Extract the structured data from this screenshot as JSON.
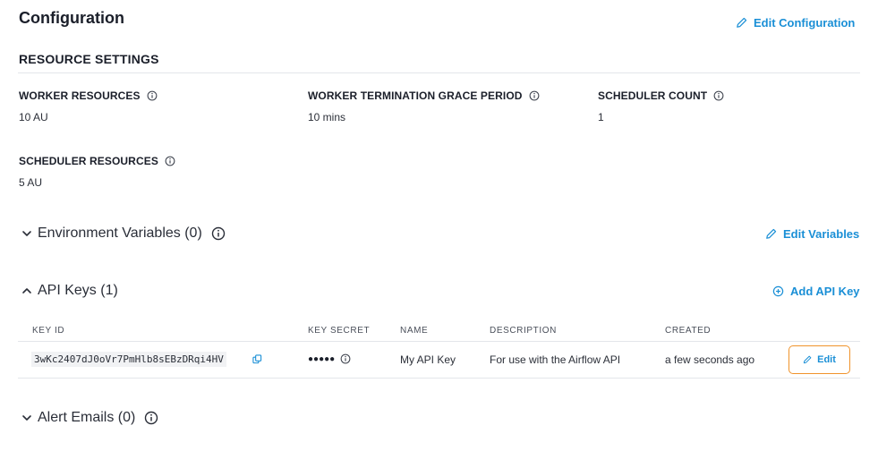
{
  "header": {
    "title": "Configuration",
    "edit_configuration_label": "Edit Configuration"
  },
  "resource_settings": {
    "heading": "RESOURCE SETTINGS",
    "fields": [
      {
        "label": "WORKER RESOURCES",
        "value": "10 AU"
      },
      {
        "label": "WORKER TERMINATION GRACE PERIOD",
        "value": "10 mins"
      },
      {
        "label": "SCHEDULER COUNT",
        "value": "1"
      },
      {
        "label": "SCHEDULER RESOURCES",
        "value": "5 AU"
      }
    ]
  },
  "env_vars": {
    "label": "Environment Variables (0)",
    "action_label": "Edit Variables",
    "state": "collapsed"
  },
  "api_keys": {
    "label": "API Keys (1)",
    "action_label": "Add API Key",
    "state": "expanded",
    "columns": [
      "KEY ID",
      "KEY SECRET",
      "NAME",
      "DESCRIPTION",
      "CREATED"
    ],
    "rows": [
      {
        "key_id": "3wKc2407dJ0oVr7PmHlb8sEBzDRqi4HV",
        "key_secret": "●●●●●",
        "name": "My API Key",
        "description": "For use with the Airflow API",
        "created": "a few seconds ago",
        "edit_label": "Edit"
      }
    ]
  },
  "alert_emails": {
    "label": "Alert Emails (0)",
    "state": "collapsed"
  },
  "colors": {
    "accent": "#1a8fd6",
    "focus_outline": "#f0932b",
    "divider": "#e3e6ea"
  },
  "icons": {
    "edit": "pencil-icon",
    "info": "info-icon",
    "add": "plus-circle-icon",
    "copy": "copy-icon",
    "expand": "chevron-down-icon",
    "collapse": "chevron-up-icon"
  }
}
